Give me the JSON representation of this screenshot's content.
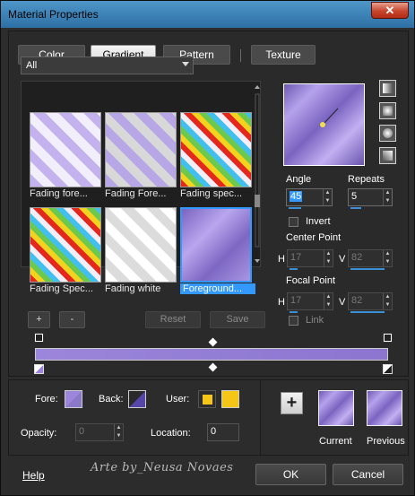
{
  "window": {
    "title": "Material Properties",
    "close_glyph": "✕"
  },
  "tabs": [
    {
      "label": "Color"
    },
    {
      "label": "Gradient"
    },
    {
      "label": "Pattern"
    },
    {
      "label": "Texture"
    }
  ],
  "filter": {
    "selected": "All"
  },
  "gradients": [
    {
      "label": "Fading fore..."
    },
    {
      "label": "Fading Fore..."
    },
    {
      "label": "Fading spec..."
    },
    {
      "label": "Fading Spec..."
    },
    {
      "label": "Fading white"
    },
    {
      "label": "Foreground..."
    }
  ],
  "list_buttons": {
    "add": "+",
    "remove": "-",
    "reset": "Reset",
    "save": "Save"
  },
  "angle": {
    "label": "Angle",
    "value": "45"
  },
  "repeats": {
    "label": "Repeats",
    "value": "5"
  },
  "invert": {
    "label": "Invert"
  },
  "center_point": {
    "label": "Center Point",
    "h_label": "H",
    "h": "17",
    "v_label": "V",
    "v": "82"
  },
  "focal_point": {
    "label": "Focal Point",
    "h_label": "H",
    "h": "17",
    "v_label": "V",
    "v": "82"
  },
  "link": {
    "label": "Link"
  },
  "colors": {
    "fore_label": "Fore:",
    "back_label": "Back:",
    "user_label": "User:",
    "user_color": "#f5c518",
    "accent": "#3399ff"
  },
  "opacity": {
    "label": "Opacity:",
    "value": "0"
  },
  "location": {
    "label": "Location:",
    "value": "0"
  },
  "current_label": "Current",
  "previous_label": "Previous",
  "add_glyph": "+",
  "watermark": "Arte by_Neusa Novaes",
  "help": "Help",
  "ok": "OK",
  "cancel": "Cancel"
}
